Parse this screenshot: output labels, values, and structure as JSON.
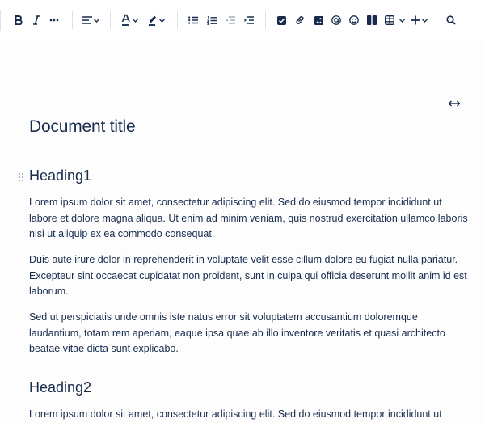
{
  "toolbar": {
    "bold_icon": "bold-icon",
    "italic_icon": "italic-icon",
    "more_formatting_icon": "more-icon",
    "alignment_icon": "align-left-icon",
    "text_color_icon": "text-color-icon",
    "highlight_icon": "highlight-icon",
    "bullet_list_icon": "bullet-list-icon",
    "numbered_list_icon": "numbered-list-icon",
    "outdent_icon": "outdent-icon",
    "indent_icon": "indent-icon",
    "action_item_icon": "checkbox-icon",
    "link_icon": "link-icon",
    "image_icon": "image-icon",
    "mention_icon": "mention-icon",
    "emoji_icon": "emoji-icon",
    "layout_icon": "layout-icon",
    "table_icon": "table-icon",
    "insert_icon": "plus-icon",
    "search_icon": "search-icon",
    "colors": {
      "text": "#172b4d",
      "disabled": "#a5adba",
      "divider": "#dfe1e6"
    }
  },
  "document": {
    "title": "Document title",
    "heading1": "Heading1",
    "paragraph1": "Lorem ipsum dolor sit amet, consectetur adipiscing elit. Sed do eiusmod tempor incididunt ut labore et dolore magna aliqua. Ut enim ad minim veniam, quis nostrud exercitation ullamco laboris nisi ut aliquip ex ea commodo consequat.",
    "paragraph2": "Duis aute irure dolor in reprehenderit in voluptate velit esse cillum dolore eu fugiat nulla pariatur. Excepteur sint occaecat cupidatat non proident, sunt in culpa qui officia deserunt mollit anim id est laborum.",
    "paragraph3": "Sed ut perspiciatis unde omnis iste natus error sit voluptatem accusantium doloremque laudantium, totam rem aperiam, eaque ipsa quae ab illo inventore veritatis et quasi architecto beatae vitae dicta sunt explicabo.",
    "heading2": "Heading2",
    "paragraph4": "Lorem ipsum dolor sit amet, consectetur adipiscing elit. Sed do eiusmod tempor incididunt ut labore et"
  },
  "canvas": {
    "width_toggle_icon": "expand-width-icon"
  }
}
